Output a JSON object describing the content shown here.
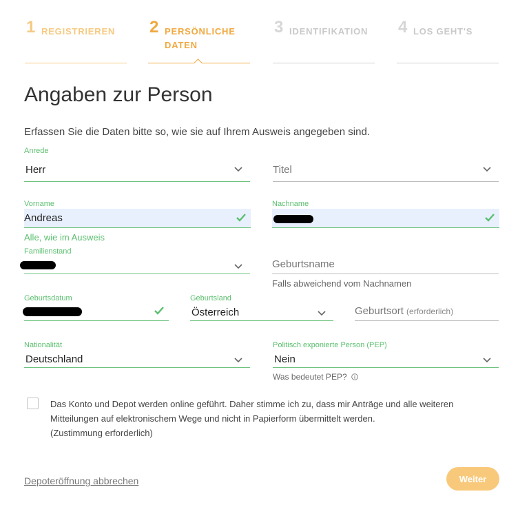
{
  "steps": [
    {
      "number": "1",
      "label": "REGISTRIEREN",
      "state": "done"
    },
    {
      "number": "2",
      "label_line1": "PERSÖNLICHE",
      "label_line2": "DATEN",
      "state": "active"
    },
    {
      "number": "3",
      "label": "IDENTIFIKATION",
      "state": "todo"
    },
    {
      "number": "4",
      "label": "LOS GEHT'S",
      "state": "todo"
    }
  ],
  "title": "Angaben zur Person",
  "intro": "Erfassen Sie die Daten bitte so, wie sie auf Ihrem Ausweis angegeben sind.",
  "form": {
    "anrede": {
      "label": "Anrede",
      "value": "Herr"
    },
    "titel": {
      "placeholder": "Titel"
    },
    "vorname": {
      "label": "Vorname",
      "value": "Andreas",
      "hint": "Alle, wie im Ausweis"
    },
    "nachname": {
      "label": "Nachname",
      "value": "[redacted]"
    },
    "familienstand": {
      "label": "Familienstand",
      "value": "[redacted]"
    },
    "geburtsname": {
      "placeholder": "Geburtsname",
      "hint": "Falls abweichend vom Nachnamen"
    },
    "geburtsdatum": {
      "label": "Geburtsdatum",
      "value": "[redacted]"
    },
    "geburtsland": {
      "label": "Geburtsland",
      "value": "Österreich"
    },
    "geburtsort": {
      "placeholder": "Geburtsort",
      "placeholder_note": "(erforderlich)"
    },
    "nationalitaet": {
      "label": "Nationalität",
      "value": "Deutschland"
    },
    "pep": {
      "label": "Politisch exponierte Person (PEP)",
      "value": "Nein",
      "help": "Was bedeutet PEP?"
    }
  },
  "consent": {
    "line1": "Das Konto und Depot werden online geführt. Daher stimme ich zu, dass mir Anträge und alle weiteren",
    "line2": "Mitteilungen auf elektronischem Wege und nicht in Papierform übermittelt werden.",
    "line3": "(Zustimmung erforderlich)",
    "checked": false
  },
  "actions": {
    "cancel": "Depoteröffnung abbrechen",
    "next": "Weiter"
  },
  "colors": {
    "accent": "#f0a940",
    "accent_light": "#f9c97b",
    "valid": "#5bbf6f",
    "autofill": "#e8f0fe"
  },
  "icons": [
    "chevron-down-icon",
    "checkmark-icon",
    "info-icon",
    "checkbox-icon"
  ]
}
